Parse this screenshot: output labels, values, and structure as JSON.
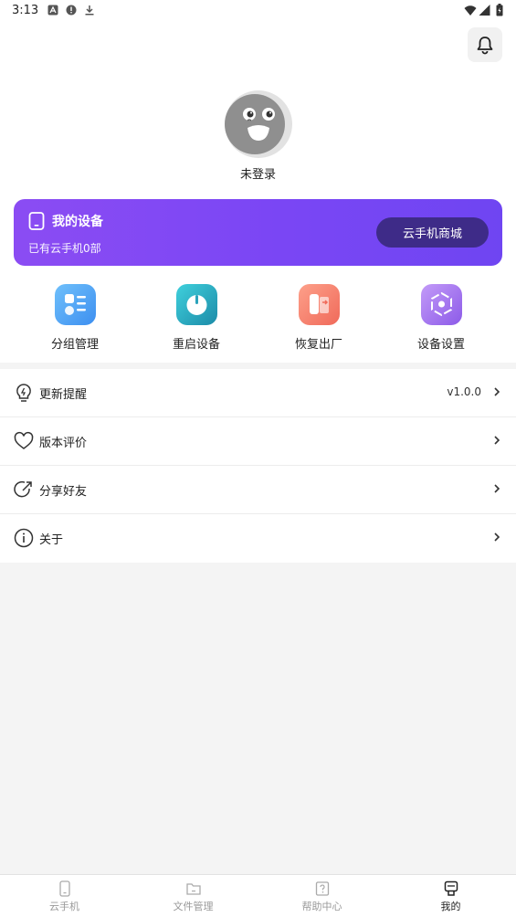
{
  "status_bar": {
    "time": "3:13"
  },
  "profile": {
    "login_status": "未登录"
  },
  "device_card": {
    "title": "我的设备",
    "count_text": "已有云手机0部",
    "shop_button": "云手机商城",
    "colors": {
      "gradient_start": "#8b4cf3",
      "gradient_end": "#6f45f2",
      "button": "#3e2b88"
    }
  },
  "quick_actions": [
    {
      "label": "分组管理",
      "icon": "group-manage-icon",
      "color": "#4aa3f5"
    },
    {
      "label": "重启设备",
      "icon": "power-icon",
      "color": "#2fb5c9"
    },
    {
      "label": "恢复出厂",
      "icon": "factory-reset-icon",
      "color": "#f6806e"
    },
    {
      "label": "设备设置",
      "icon": "device-settings-icon",
      "color": "#a77cf0"
    }
  ],
  "menu": [
    {
      "label": "更新提醒",
      "icon": "bulb-icon",
      "value": "v1.0.0"
    },
    {
      "label": "版本评价",
      "icon": "heart-icon"
    },
    {
      "label": "分享好友",
      "icon": "share-icon"
    },
    {
      "label": "关于",
      "icon": "info-icon"
    }
  ],
  "bottom_nav": [
    {
      "label": "云手机",
      "icon": "phone-icon",
      "active": false
    },
    {
      "label": "文件管理",
      "icon": "folder-icon",
      "active": false
    },
    {
      "label": "帮助中心",
      "icon": "help-icon",
      "active": false
    },
    {
      "label": "我的",
      "icon": "profile-icon",
      "active": true
    }
  ]
}
